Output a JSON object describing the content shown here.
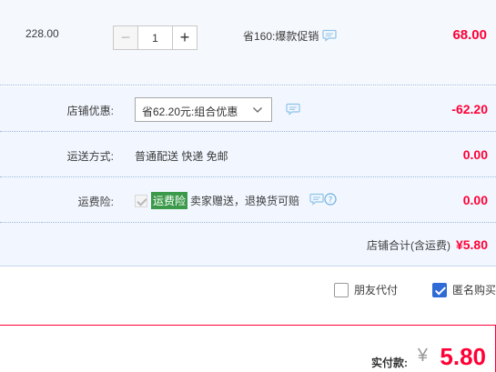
{
  "item": {
    "unit_price": "228.00",
    "quantity": "1",
    "decrease_label": "−",
    "increase_label": "+",
    "promo": "省160:爆款促销",
    "total": "68.00"
  },
  "shop_discount": {
    "label": "店铺优惠:",
    "selected": "省62.20元:组合优惠",
    "value": "-62.20"
  },
  "shipping": {
    "label": "运送方式:",
    "text": "普通配送 快递 免邮",
    "value": "0.00"
  },
  "insurance": {
    "label": "运费险:",
    "tag": "运费险",
    "text": "卖家赠送，退换货可赔",
    "value": "0.00"
  },
  "shop_total": {
    "label": "店铺合计(含运费)",
    "amount": "¥5.80"
  },
  "options": {
    "friend_pay": "朋友代付",
    "anonymous": "匿名购买"
  },
  "payment": {
    "label": "实付款:",
    "currency": "¥",
    "amount": "5.80"
  },
  "colors": {
    "price_red": "#ff0036",
    "panel_bg": "#f2f7ff",
    "checkbox_blue": "#2e6bd6",
    "tag_green": "#3b9a4a"
  }
}
